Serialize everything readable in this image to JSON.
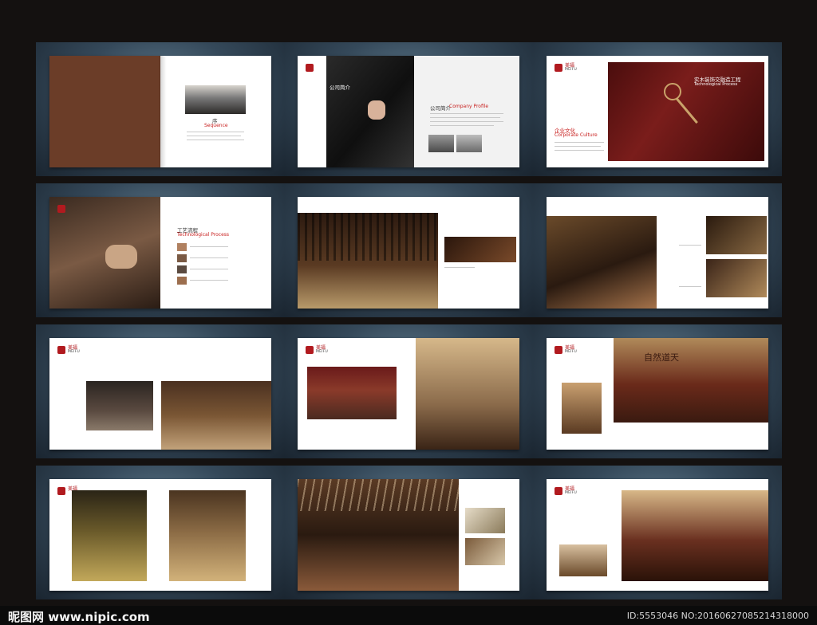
{
  "brochure": {
    "logo_zh": "美福",
    "logo_en": "MEIFU",
    "sequence": {
      "zh": "序",
      "en": "Sequence"
    },
    "company_profile": {
      "zh": "公司简介",
      "en": "Company Profile"
    },
    "technological_process": {
      "zh": "工艺流程",
      "en": "Technological Process"
    },
    "corporate_culture": {
      "zh": "企业文化",
      "en": "Corporate Culture"
    },
    "hero_title": "实木装饰交融造工程",
    "hero_sub": "Technological Process",
    "calligraphy": "自然道天",
    "cover_color": "#6b3d28",
    "accent_color": "#c8201f"
  },
  "watermark": {
    "site": "昵图网 www.nipic.com",
    "image_id": "ID:5553046 NO:20160627085214318000"
  }
}
